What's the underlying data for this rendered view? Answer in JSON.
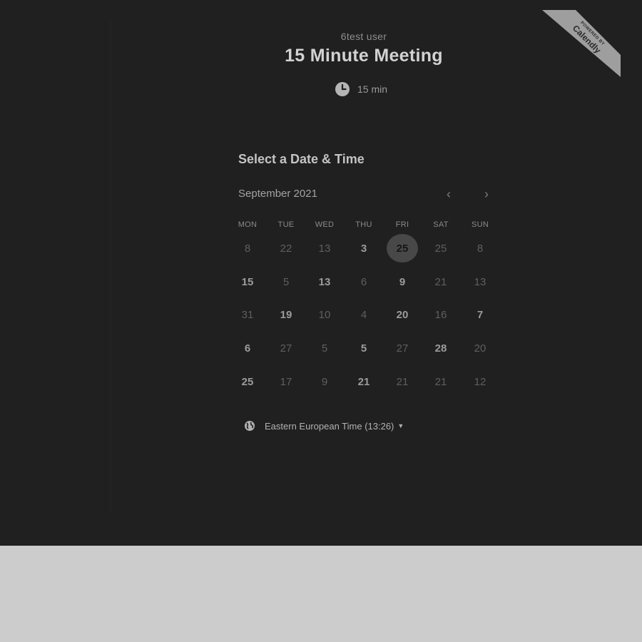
{
  "organizer_name": "6test user",
  "event_title": "15 Minute Meeting",
  "duration": {
    "icon": "clock-icon",
    "label": "15 min"
  },
  "branding": {
    "small": "POWERED BY",
    "brand": "Calendly"
  },
  "scheduler": {
    "heading": "Select a Date & Time",
    "month_label": "September 2021",
    "prev_icon": "chevron-left-icon",
    "next_icon": "chevron-right-icon",
    "weekdays": [
      "MON",
      "TUE",
      "WED",
      "THU",
      "FRI",
      "SAT",
      "SUN"
    ],
    "weeks": [
      [
        {
          "label": "8",
          "available": false,
          "selected": false
        },
        {
          "label": "22",
          "available": false,
          "selected": false
        },
        {
          "label": "13",
          "available": false,
          "selected": false
        },
        {
          "label": "3",
          "available": true,
          "selected": false
        },
        {
          "label": "25",
          "available": true,
          "selected": true
        },
        {
          "label": "25",
          "available": false,
          "selected": false
        },
        {
          "label": "8",
          "available": false,
          "selected": false
        }
      ],
      [
        {
          "label": "15",
          "available": true,
          "selected": false
        },
        {
          "label": "5",
          "available": false,
          "selected": false
        },
        {
          "label": "13",
          "available": true,
          "selected": false
        },
        {
          "label": "6",
          "available": false,
          "selected": false
        },
        {
          "label": "9",
          "available": true,
          "selected": false
        },
        {
          "label": "21",
          "available": false,
          "selected": false
        },
        {
          "label": "13",
          "available": false,
          "selected": false
        }
      ],
      [
        {
          "label": "31",
          "available": false,
          "selected": false
        },
        {
          "label": "19",
          "available": true,
          "selected": false
        },
        {
          "label": "10",
          "available": false,
          "selected": false
        },
        {
          "label": "4",
          "available": false,
          "selected": false
        },
        {
          "label": "20",
          "available": true,
          "selected": false
        },
        {
          "label": "16",
          "available": false,
          "selected": false
        },
        {
          "label": "7",
          "available": true,
          "selected": false
        }
      ],
      [
        {
          "label": "6",
          "available": true,
          "selected": false
        },
        {
          "label": "27",
          "available": false,
          "selected": false
        },
        {
          "label": "5",
          "available": false,
          "selected": false
        },
        {
          "label": "5",
          "available": true,
          "selected": false
        },
        {
          "label": "27",
          "available": false,
          "selected": false
        },
        {
          "label": "28",
          "available": true,
          "selected": false
        },
        {
          "label": "20",
          "available": false,
          "selected": false
        }
      ],
      [
        {
          "label": "25",
          "available": true,
          "selected": false
        },
        {
          "label": "17",
          "available": false,
          "selected": false
        },
        {
          "label": "9",
          "available": false,
          "selected": false
        },
        {
          "label": "21",
          "available": true,
          "selected": false
        },
        {
          "label": "21",
          "available": false,
          "selected": false
        },
        {
          "label": "21",
          "available": false,
          "selected": false
        },
        {
          "label": "12",
          "available": false,
          "selected": false
        }
      ]
    ]
  },
  "timezone": {
    "icon": "globe-icon",
    "label": "Eastern European Time (13:26)",
    "caret_icon": "caret-down-icon"
  },
  "colors": {
    "background": "#202020",
    "page_bottom": "#cccccc",
    "selected_day": "#484848"
  }
}
